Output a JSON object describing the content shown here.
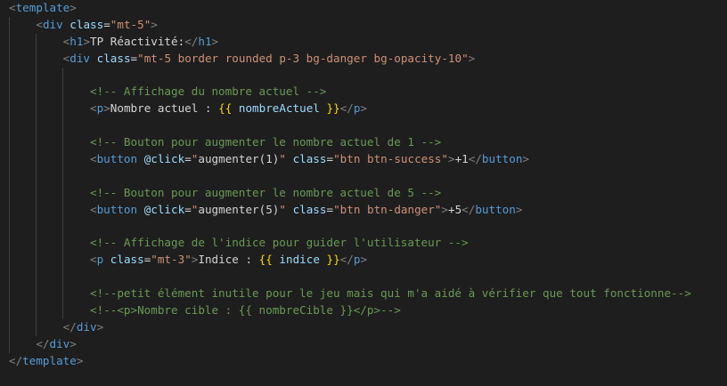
{
  "editor": {
    "lines": [
      {
        "indent": 0,
        "tokens": [
          [
            "p",
            "<"
          ],
          [
            "t",
            "template"
          ],
          [
            "p",
            ">"
          ]
        ]
      },
      {
        "indent": 1,
        "tokens": [
          [
            "p",
            "<"
          ],
          [
            "t",
            "div"
          ],
          [
            "x",
            " "
          ],
          [
            "a",
            "class"
          ],
          [
            "x",
            "="
          ],
          [
            "s",
            "\"mt-5\""
          ],
          [
            "p",
            ">"
          ]
        ]
      },
      {
        "indent": 2,
        "tokens": [
          [
            "p",
            "<"
          ],
          [
            "t",
            "h1"
          ],
          [
            "p",
            ">"
          ],
          [
            "x",
            "TP Réactivité:"
          ],
          [
            "p",
            "</"
          ],
          [
            "t",
            "h1"
          ],
          [
            "p",
            ">"
          ]
        ]
      },
      {
        "indent": 2,
        "tokens": [
          [
            "p",
            "<"
          ],
          [
            "t",
            "div"
          ],
          [
            "x",
            " "
          ],
          [
            "a",
            "class"
          ],
          [
            "x",
            "="
          ],
          [
            "s",
            "\"mt-5 border rounded p-3 bg-danger bg-opacity-10\""
          ],
          [
            "p",
            ">"
          ]
        ]
      },
      {
        "indent": 0,
        "tokens": []
      },
      {
        "indent": 3,
        "tokens": [
          [
            "c",
            "<!-- Affichage du nombre actuel -->"
          ]
        ]
      },
      {
        "indent": 3,
        "tokens": [
          [
            "p",
            "<"
          ],
          [
            "t",
            "p"
          ],
          [
            "p",
            ">"
          ],
          [
            "x",
            "Nombre actuel : "
          ],
          [
            "m",
            "{{"
          ],
          [
            "x",
            " "
          ],
          [
            "v",
            "nombreActuel"
          ],
          [
            "x",
            " "
          ],
          [
            "m",
            "}}"
          ],
          [
            "p",
            "</"
          ],
          [
            "t",
            "p"
          ],
          [
            "p",
            ">"
          ]
        ]
      },
      {
        "indent": 0,
        "tokens": []
      },
      {
        "indent": 3,
        "tokens": [
          [
            "c",
            "<!-- Bouton pour augmenter le nombre actuel de 1 -->"
          ]
        ]
      },
      {
        "indent": 3,
        "tokens": [
          [
            "p",
            "<"
          ],
          [
            "t",
            "button"
          ],
          [
            "x",
            " "
          ],
          [
            "a",
            "@click"
          ],
          [
            "x",
            "="
          ],
          [
            "s",
            "\""
          ],
          [
            "x",
            "augmenter(1)"
          ],
          [
            "s",
            "\""
          ],
          [
            "x",
            " "
          ],
          [
            "a",
            "class"
          ],
          [
            "x",
            "="
          ],
          [
            "s",
            "\"btn btn-success\""
          ],
          [
            "p",
            ">"
          ],
          [
            "x",
            "+1"
          ],
          [
            "p",
            "</"
          ],
          [
            "t",
            "button"
          ],
          [
            "p",
            ">"
          ]
        ]
      },
      {
        "indent": 0,
        "tokens": []
      },
      {
        "indent": 3,
        "tokens": [
          [
            "c",
            "<!-- Bouton pour augmenter le nombre actuel de 5 -->"
          ]
        ]
      },
      {
        "indent": 3,
        "tokens": [
          [
            "p",
            "<"
          ],
          [
            "t",
            "button"
          ],
          [
            "x",
            " "
          ],
          [
            "a",
            "@click"
          ],
          [
            "x",
            "="
          ],
          [
            "s",
            "\""
          ],
          [
            "x",
            "augmenter(5)"
          ],
          [
            "s",
            "\""
          ],
          [
            "x",
            " "
          ],
          [
            "a",
            "class"
          ],
          [
            "x",
            "="
          ],
          [
            "s",
            "\"btn btn-danger\""
          ],
          [
            "p",
            ">"
          ],
          [
            "x",
            "+5"
          ],
          [
            "p",
            "</"
          ],
          [
            "t",
            "button"
          ],
          [
            "p",
            ">"
          ]
        ]
      },
      {
        "indent": 0,
        "tokens": []
      },
      {
        "indent": 3,
        "tokens": [
          [
            "c",
            "<!-- Affichage de l'indice pour guider l'utilisateur -->"
          ]
        ]
      },
      {
        "indent": 3,
        "tokens": [
          [
            "p",
            "<"
          ],
          [
            "t",
            "p"
          ],
          [
            "x",
            " "
          ],
          [
            "a",
            "class"
          ],
          [
            "x",
            "="
          ],
          [
            "s",
            "\"mt-3\""
          ],
          [
            "p",
            ">"
          ],
          [
            "x",
            "Indice : "
          ],
          [
            "m",
            "{{"
          ],
          [
            "x",
            " "
          ],
          [
            "v",
            "indice"
          ],
          [
            "x",
            " "
          ],
          [
            "m",
            "}}"
          ],
          [
            "p",
            "</"
          ],
          [
            "t",
            "p"
          ],
          [
            "p",
            ">"
          ]
        ]
      },
      {
        "indent": 0,
        "tokens": []
      },
      {
        "indent": 3,
        "tokens": [
          [
            "c",
            "<!--petit élément inutile pour le jeu mais qui m'a aidé à vérifier que tout fonctionne-->"
          ]
        ]
      },
      {
        "indent": 3,
        "tokens": [
          [
            "c",
            "<!--<p>Nombre cible : {{ nombreCible }}</p>-->"
          ]
        ]
      },
      {
        "indent": 2,
        "tokens": [
          [
            "p",
            "</"
          ],
          [
            "t",
            "div"
          ],
          [
            "p",
            ">"
          ]
        ]
      },
      {
        "indent": 1,
        "tokens": [
          [
            "p",
            "</"
          ],
          [
            "t",
            "div"
          ],
          [
            "p",
            ">"
          ]
        ]
      },
      {
        "indent": 0,
        "tokens": [
          [
            "p",
            "</"
          ],
          [
            "t",
            "template"
          ],
          [
            "p",
            ">"
          ]
        ]
      }
    ],
    "guides": [
      {
        "line": 1,
        "levels": [
          0
        ]
      },
      {
        "line": 2,
        "levels": [
          0,
          1
        ]
      },
      {
        "line": 3,
        "levels": [
          0,
          1
        ]
      },
      {
        "line": 4,
        "levels": [
          0,
          1,
          2
        ]
      },
      {
        "line": 5,
        "levels": [
          0,
          1,
          2
        ]
      },
      {
        "line": 6,
        "levels": [
          0,
          1,
          2
        ]
      },
      {
        "line": 7,
        "levels": [
          0,
          1,
          2
        ]
      },
      {
        "line": 8,
        "levels": [
          0,
          1,
          2
        ]
      },
      {
        "line": 9,
        "levels": [
          0,
          1,
          2
        ]
      },
      {
        "line": 10,
        "levels": [
          0,
          1,
          2
        ]
      },
      {
        "line": 11,
        "levels": [
          0,
          1,
          2
        ]
      },
      {
        "line": 12,
        "levels": [
          0,
          1,
          2
        ]
      },
      {
        "line": 13,
        "levels": [
          0,
          1,
          2
        ]
      },
      {
        "line": 14,
        "levels": [
          0,
          1,
          2
        ]
      },
      {
        "line": 15,
        "levels": [
          0,
          1,
          2
        ]
      },
      {
        "line": 16,
        "levels": [
          0,
          1,
          2
        ]
      },
      {
        "line": 17,
        "levels": [
          0,
          1,
          2
        ]
      },
      {
        "line": 18,
        "levels": [
          0,
          1,
          2
        ]
      },
      {
        "line": 19,
        "levels": [
          0,
          1
        ]
      },
      {
        "line": 20,
        "levels": [
          0
        ]
      }
    ],
    "colors": {
      "background": "#1e1e1e",
      "punctuation": "#808080",
      "tag": "#569cd6",
      "attribute": "#9cdcfe",
      "string": "#ce9178",
      "comment": "#6a9955",
      "mustache": "#ffd700",
      "text": "#d4d4d4"
    }
  }
}
